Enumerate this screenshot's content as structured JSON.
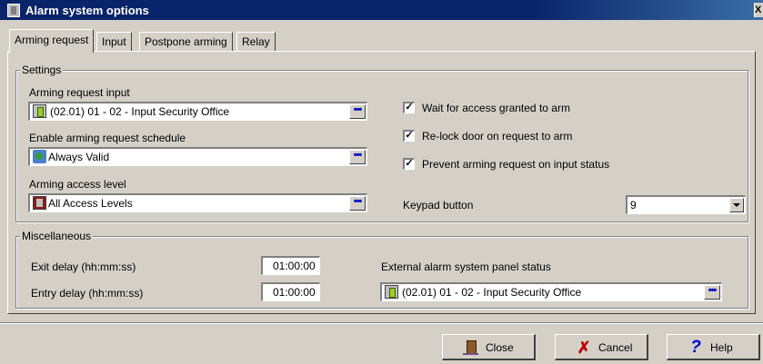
{
  "window": {
    "title": "Alarm system options",
    "close_glyph": "X"
  },
  "tabs": [
    {
      "label": "Arming request",
      "active": true
    },
    {
      "label": "Input",
      "active": false
    },
    {
      "label": "Postpone arming",
      "active": false
    },
    {
      "label": "Relay",
      "active": false
    }
  ],
  "settings": {
    "legend": "Settings",
    "arming_request_input": {
      "label": "Arming request input",
      "value": "(02.01) 01 - 02 - Input Security Office",
      "icon": "door-input-icon"
    },
    "enable_schedule": {
      "label": "Enable arming request schedule",
      "value": "Always Valid",
      "icon": "schedule-globe-icon"
    },
    "arming_access_level": {
      "label": "Arming access level",
      "value": "All Access Levels",
      "icon": "access-level-icon"
    },
    "ellipsis_glyph": "•••",
    "checkboxes": [
      {
        "label": "Wait for access granted to arm",
        "checked": true
      },
      {
        "label": "Re-lock door on request to arm",
        "checked": true
      },
      {
        "label": "Prevent arming request on input status",
        "checked": true
      }
    ],
    "check_glyph": "✓",
    "keypad": {
      "label": "Keypad button",
      "value": "9"
    }
  },
  "misc": {
    "legend": "Miscellaneous",
    "exit_delay": {
      "label": "Exit delay (hh:mm:ss)",
      "value": "01:00:00"
    },
    "entry_delay": {
      "label": "Entry delay (hh:mm:ss)",
      "value": "01:00:00"
    },
    "external_status": {
      "label": "External alarm system panel status",
      "value": "(02.01) 01 - 02 - Input Security Office",
      "icon": "door-input-icon"
    }
  },
  "buttons": {
    "close": {
      "label": "Close",
      "icon": "door-close-icon"
    },
    "cancel": {
      "label": "Cancel",
      "icon": "x-icon",
      "glyph": "✗"
    },
    "help": {
      "label": "Help",
      "icon": "question-icon",
      "glyph": "?"
    }
  },
  "colors": {
    "titlebar": "#0a246a",
    "face": "#d4d0c8",
    "ellipsis": "#0000c0",
    "cancel": "#c00000",
    "help": "#0000d0"
  }
}
